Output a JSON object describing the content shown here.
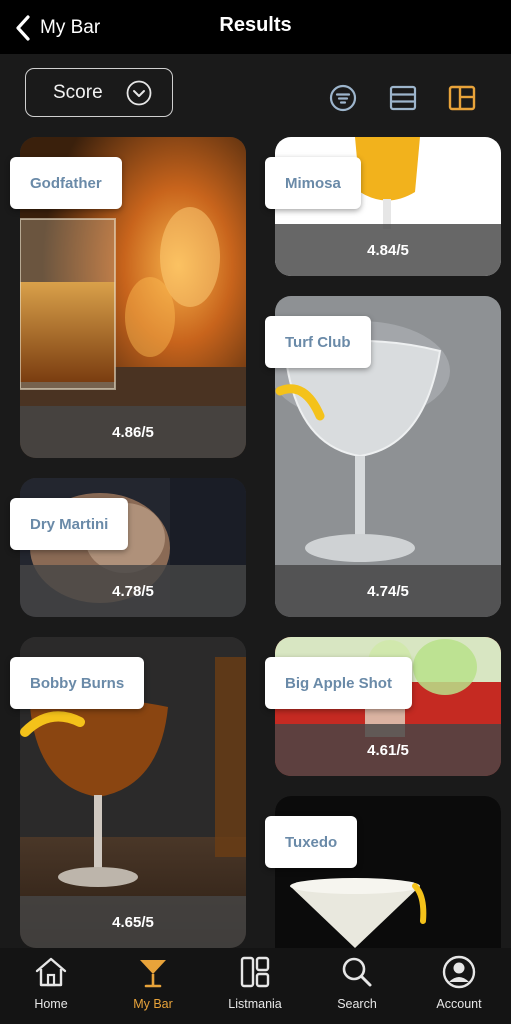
{
  "header": {
    "back_label": "My Bar",
    "title": "Results"
  },
  "sort": {
    "selected": "Score"
  },
  "view_icons": [
    "filter-icon",
    "list-view-icon",
    "grid-view-icon"
  ],
  "accent_color": "#e8a33a",
  "cards": [
    {
      "name": "Godfather",
      "rating": "4.86/5"
    },
    {
      "name": "Mimosa",
      "rating": "4.84/5"
    },
    {
      "name": "Turf Club",
      "rating": "4.74/5"
    },
    {
      "name": "Dry Martini",
      "rating": "4.78/5"
    },
    {
      "name": "Bobby Burns",
      "rating": "4.65/5"
    },
    {
      "name": "Big Apple Shot",
      "rating": "4.61/5"
    },
    {
      "name": "Tuxedo",
      "rating": ""
    }
  ],
  "tabs": [
    {
      "label": "Home",
      "icon": "home-icon"
    },
    {
      "label": "My Bar",
      "icon": "cocktail-glass-icon",
      "active": true
    },
    {
      "label": "Listmania",
      "icon": "listmania-icon"
    },
    {
      "label": "Search",
      "icon": "search-icon"
    },
    {
      "label": "Account",
      "icon": "account-icon"
    }
  ]
}
